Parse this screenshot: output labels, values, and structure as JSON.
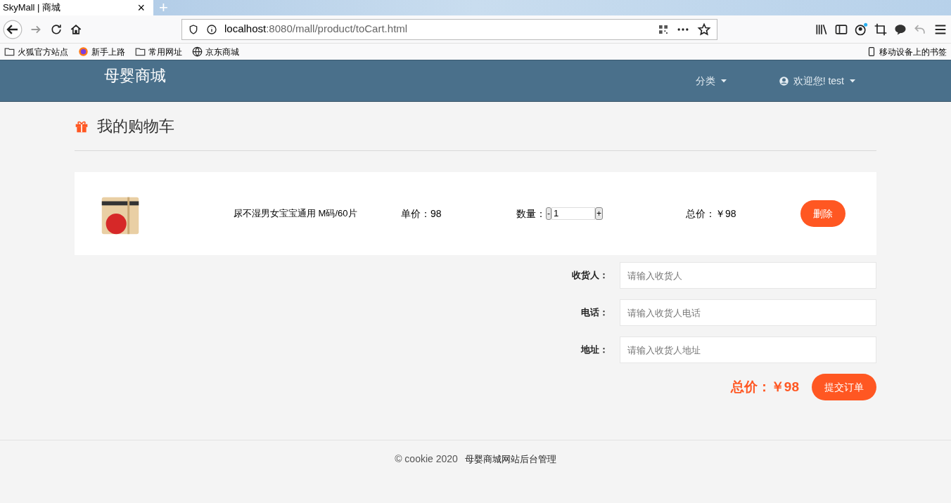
{
  "browser": {
    "tab_title": "SkyMall | 商城",
    "new_tab": "+",
    "close": "×",
    "url_host": "localhost",
    "url_path": ":8080/mall/product/toCart.html",
    "bookmarks": [
      {
        "kind": "folder",
        "label": "火狐官方站点"
      },
      {
        "kind": "firefox",
        "label": "新手上路"
      },
      {
        "kind": "folder",
        "label": "常用网址"
      },
      {
        "kind": "globe",
        "label": "京东商城"
      }
    ],
    "mobile_bookmarks": "移动设备上的书签"
  },
  "navbar": {
    "brand": "母婴商城",
    "menus": [
      {
        "kind": "plain",
        "label": "分类"
      },
      {
        "kind": "user",
        "label": "欢迎您! test"
      }
    ]
  },
  "page_title": "我的购物车",
  "cart_items": [
    {
      "name": "尿不湿男女宝宝通用 M码/60片",
      "unit_price": "单价：98",
      "quantity_label": "数量：",
      "minus": "-",
      "quantity": "1",
      "plus": "+",
      "total": "总价：￥98",
      "delete": "删除"
    }
  ],
  "form": [
    {
      "label": "收货人：",
      "placeholder": "请输入收货人"
    },
    {
      "label": "电话：",
      "placeholder": "请输入收货人电话"
    },
    {
      "label": "地址：",
      "placeholder": "请输入收货人地址"
    }
  ],
  "order_total": "总价：￥98",
  "submit": "提交订单",
  "footer": {
    "copyright": "© cookie 2020",
    "link": "母婴商城网站后台管理"
  }
}
